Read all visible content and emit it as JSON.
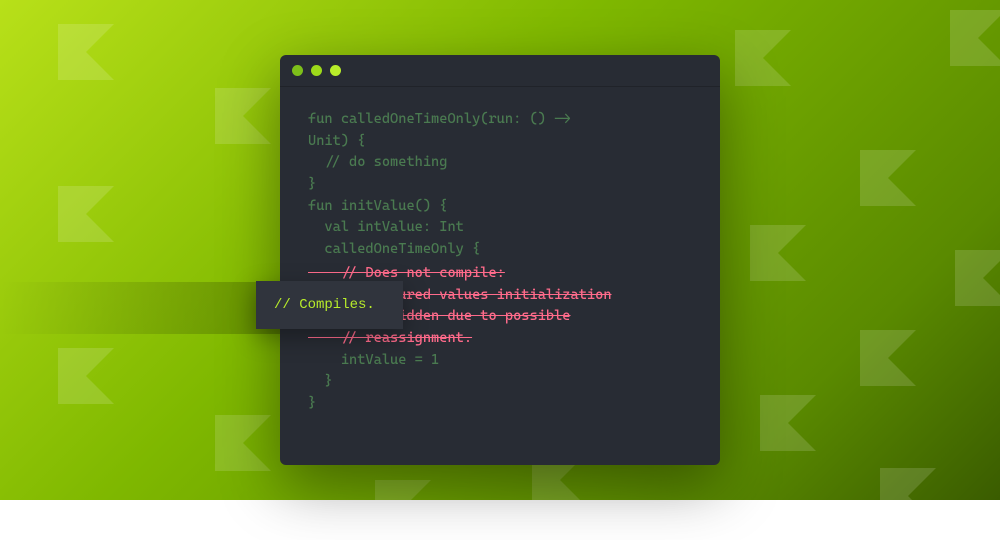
{
  "code": {
    "line1": "fun calledOneTimeOnly(run: () ->",
    "line2": "Unit) {",
    "line3": "  // do something",
    "line4": "}",
    "line5": "",
    "line6": "fun initValue() {",
    "line7": "  val intValue: Int",
    "line8": "  calledOneTimeOnly {",
    "err1": "    // Does not compile:",
    "err2": "    // Captured values initialization",
    "err3": "    // forbidden due to possible",
    "err4": "    // reassignment.",
    "line9": "    intValue = 1",
    "line10": "  }",
    "line11": "}"
  },
  "tag": {
    "text": "// Compiles."
  }
}
